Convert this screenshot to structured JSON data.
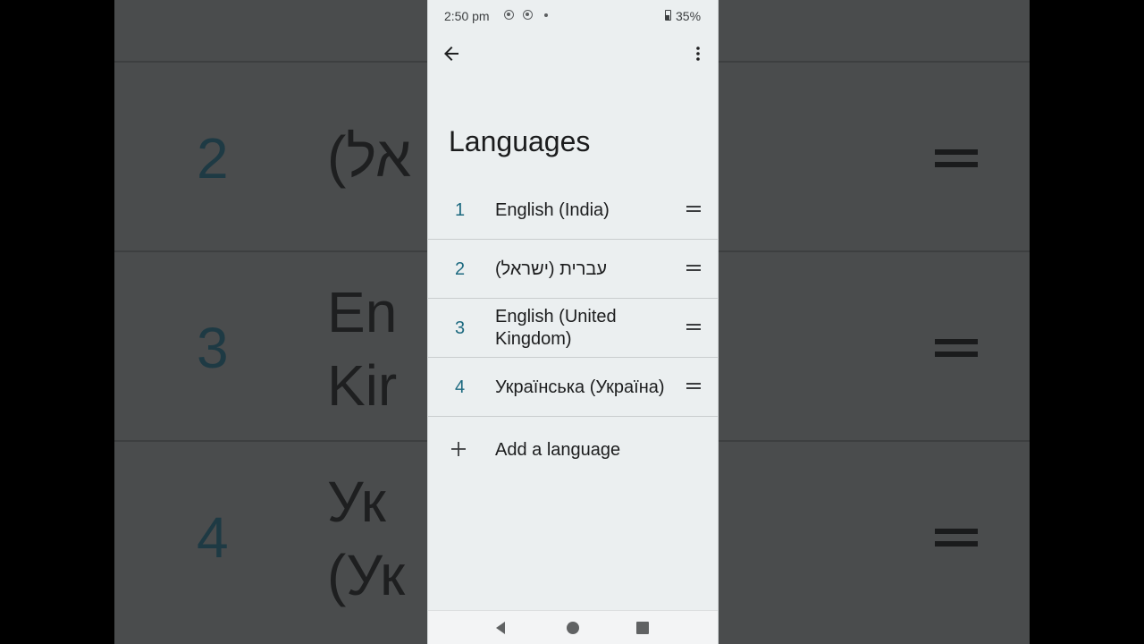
{
  "status_bar": {
    "time": "2:50 pm",
    "battery": "35%"
  },
  "toolbar": {
    "back_icon": "arrow-left-icon",
    "more_icon": "more-vert-icon"
  },
  "page": {
    "title": "Languages"
  },
  "languages": [
    {
      "index": "1",
      "label": "English (India)"
    },
    {
      "index": "2",
      "label": "עברית (ישראל)"
    },
    {
      "index": "3",
      "label": "English (United Kingdom)"
    },
    {
      "index": "4",
      "label": "Українська (Україна)"
    }
  ],
  "add_language": {
    "label": "Add a language",
    "icon": "plus-icon"
  },
  "background_zoom": {
    "items": [
      {
        "index": "2",
        "text_lines": [
          "(אל"
        ]
      },
      {
        "index": "3",
        "text_lines": [
          "En",
          "Kir"
        ]
      },
      {
        "index": "4",
        "text_lines": [
          "Ук",
          "(Ук"
        ]
      }
    ]
  },
  "colors": {
    "accent": "#1d6a80",
    "screen_bg": "#ebeff0"
  }
}
